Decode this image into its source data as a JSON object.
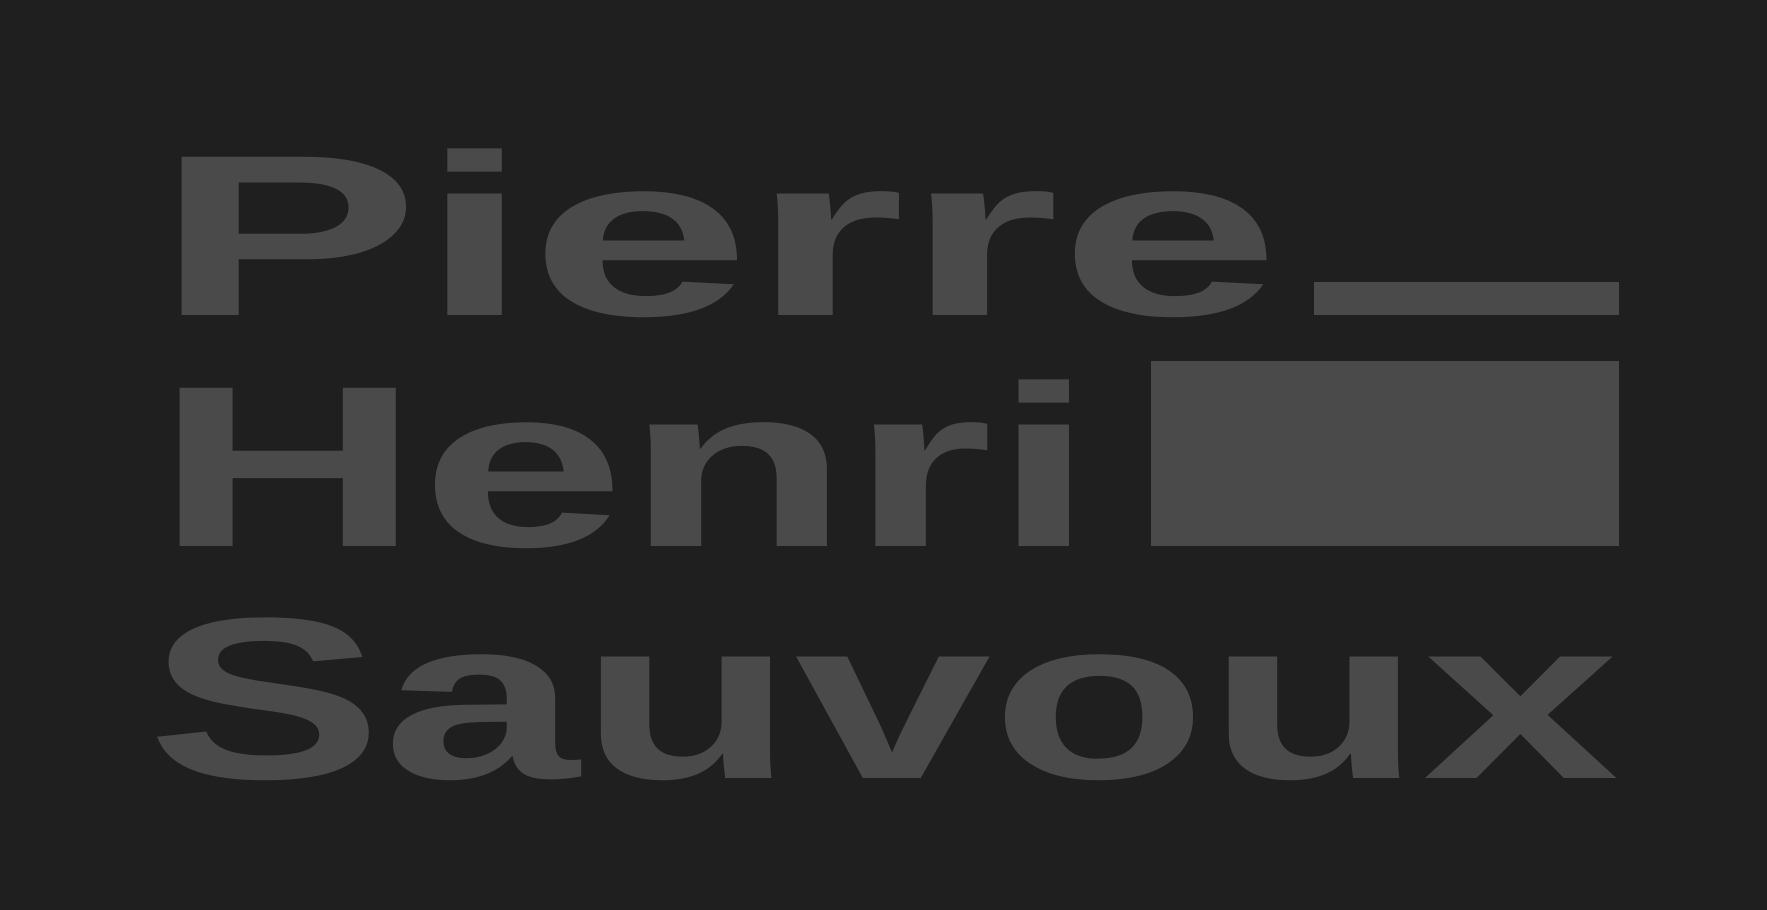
{
  "logo": {
    "line1": "Pierre",
    "line2": "Henri",
    "line3": "Sauvoux",
    "colors": {
      "background": "#1f1f1f",
      "foreground": "#4a4a4a"
    }
  }
}
